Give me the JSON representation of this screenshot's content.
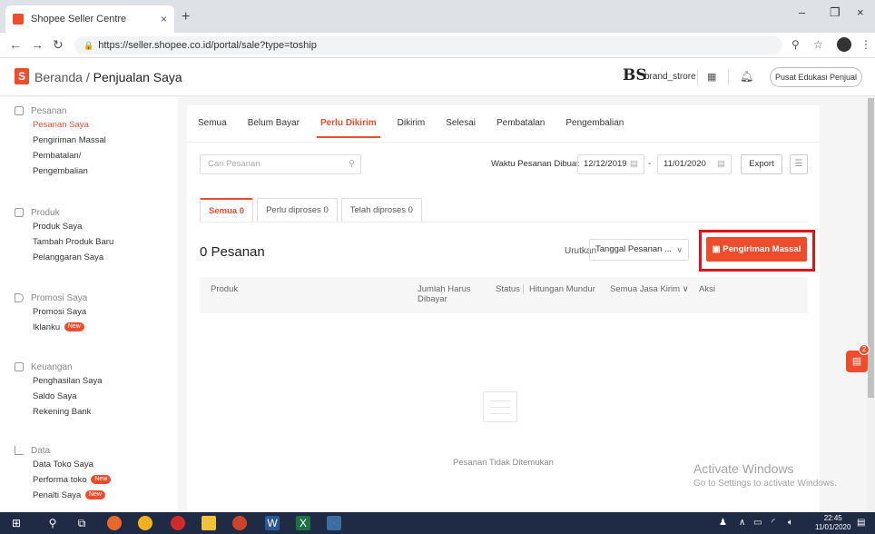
{
  "browser": {
    "tab_title": "Shopee Seller Centre",
    "tab_close": "×",
    "new_tab": "+",
    "url": "https://seller.shopee.co.id/portal/sale?type=toship",
    "win_min": "–",
    "win_max": "❐",
    "win_close": "×"
  },
  "header": {
    "logo_letter": "S",
    "breadcrumb_home": "Beranda",
    "breadcrumb_sep": " / ",
    "breadcrumb_current": "Penjualan Saya",
    "brand_logo": "BS",
    "brand_name": "brand_strore",
    "edu_button": "Pusat Edukasi Penjual"
  },
  "sidebar": {
    "groups": [
      {
        "title": "Pesanan",
        "items": [
          "Pesanan Saya",
          "Pengiriman Massal",
          "Pembatalan/",
          "Pengembalian"
        ]
      },
      {
        "title": "Produk",
        "items": [
          "Produk Saya",
          "Tambah Produk Baru",
          "Pelanggaran Saya"
        ]
      },
      {
        "title": "Promosi Saya",
        "items": [
          "Promosi Saya",
          "Iklanku"
        ]
      },
      {
        "title": "Keuangan",
        "items": [
          "Penghasilan Saya",
          "Saldo Saya",
          "Rekening Bank"
        ]
      },
      {
        "title": "Data",
        "items": [
          "Data Toko Saya",
          "Performa toko",
          "Penalti Saya"
        ]
      }
    ],
    "new_badge": "New"
  },
  "main": {
    "tabs": [
      "Semua",
      "Belum Bayar",
      "Perlu Dikirim",
      "Dikirim",
      "Selesai",
      "Pembatalan",
      "Pengembalian"
    ],
    "active_tab": "Perlu Dikirim",
    "search_placeholder": "Cari Pesanan",
    "date_label": "Waktu Pesanan Dibuat",
    "date_from": "12/12/2019",
    "date_sep": "-",
    "date_to": "11/01/2020",
    "export_label": "Export",
    "subtabs": [
      "Semua 0",
      "Perlu diproses 0",
      "Telah diproses 0"
    ],
    "order_count": "0 Pesanan",
    "sort_label": "Urutkan",
    "sort_value": "Tanggal Pesanan ...",
    "mass_button": "Pengiriman Massal",
    "columns": {
      "produk": "Produk",
      "jumlah_line1": "Jumlah Harus",
      "jumlah_line2": "Dibayar",
      "status": "Status",
      "hitungan": "Hitungan Mundur",
      "jasa": "Semua Jasa Kirim ∨",
      "aksi": "Aksi"
    },
    "empty_text": "Pesanan Tidak Ditemukan"
  },
  "chat": {
    "badge": "2"
  },
  "watermark": {
    "line1": "Activate Windows",
    "line2": "Go to Settings to activate Windows."
  },
  "taskbar": {
    "time": "22:45",
    "date": "11/01/2020"
  },
  "colors": {
    "accent": "#ee4d2d",
    "highlight_frame": "#e0121b"
  }
}
